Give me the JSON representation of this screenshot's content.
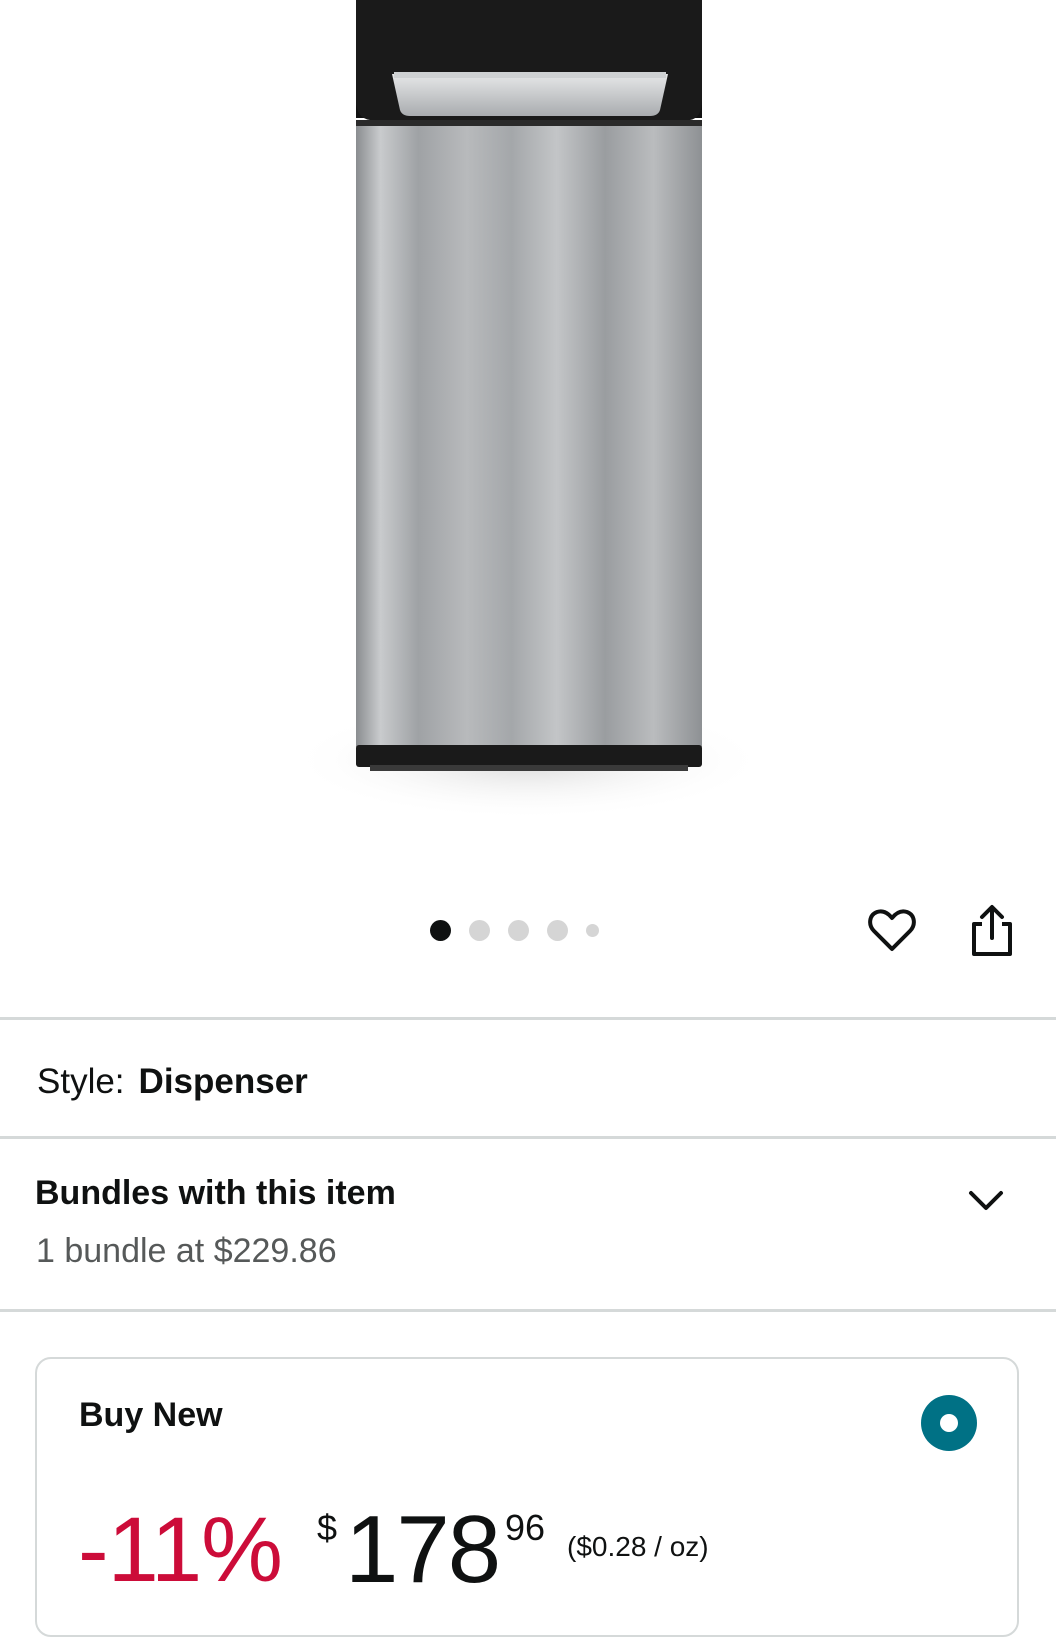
{
  "colors": {
    "discount": "#cc0c39",
    "radio_selected": "#007185",
    "divider": "#d5d9d9",
    "text_secondary": "#565959"
  },
  "gallery": {
    "image_alt": "Stainless steel water dispenser",
    "dot_count": 5,
    "active_index": 0,
    "wishlist_icon": "heart-icon",
    "share_icon": "share-icon"
  },
  "style": {
    "label": "Style:",
    "value": "Dispenser"
  },
  "bundles": {
    "title": "Bundles with this item",
    "subtitle": "1 bundle at $229.86",
    "icon": "chevron-down-icon"
  },
  "buy_new": {
    "label": "Buy New",
    "selected": true,
    "discount": "-11%",
    "currency_symbol": "$",
    "price_whole": "178",
    "price_fraction": "96",
    "unit_price": "($0.28 / oz)"
  }
}
